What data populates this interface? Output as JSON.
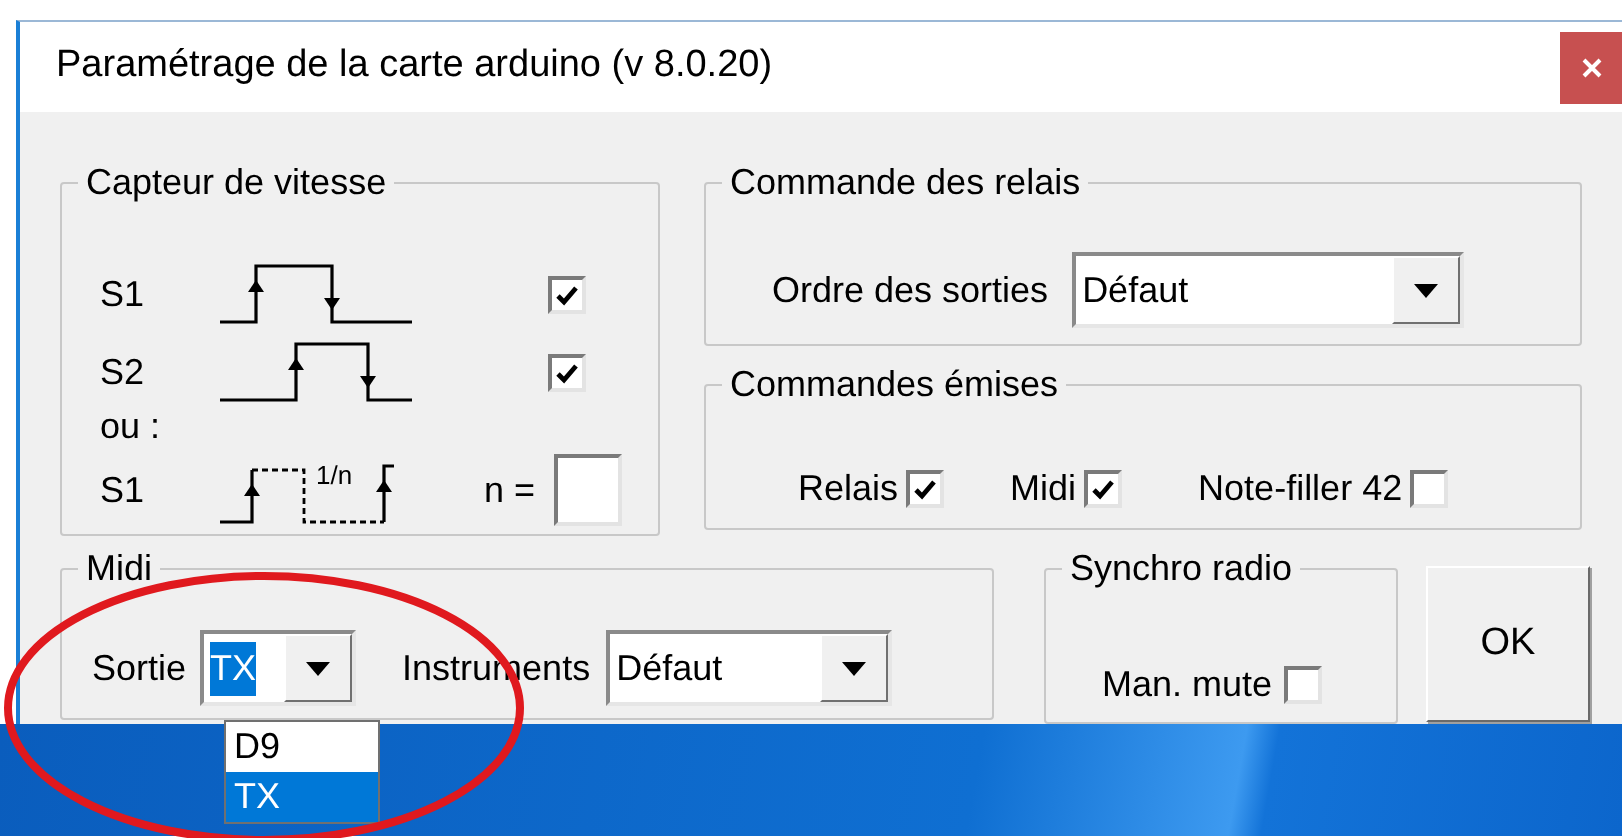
{
  "window": {
    "title": "Paramétrage de la carte arduino (v 8.0.20)"
  },
  "speed_sensor": {
    "title": "Capteur de vitesse",
    "rows": [
      {
        "kind": "checkbox",
        "label": "S1",
        "checked": true
      },
      {
        "kind": "checkbox",
        "label": "S2",
        "checked": true
      },
      {
        "kind": "note",
        "label": "ou :"
      },
      {
        "kind": "divider",
        "label": "S1",
        "ratio_label": "1/n",
        "field_label": "n ="
      }
    ]
  },
  "relay_control": {
    "title": "Commande des relais",
    "order_label": "Ordre des sorties",
    "order_value": "Défaut"
  },
  "sent_commands": {
    "title": "Commandes émises",
    "items": [
      {
        "label": "Relais",
        "checked": true
      },
      {
        "label": "Midi",
        "checked": true
      },
      {
        "label": "Note-filler 42",
        "checked": false
      }
    ]
  },
  "midi": {
    "title": "Midi",
    "output_label": "Sortie",
    "output_value": "TX",
    "instruments_label": "Instruments",
    "instruments_value": "Défaut",
    "output_options": [
      {
        "label": "D9",
        "selected": false
      },
      {
        "label": "TX",
        "selected": true
      }
    ]
  },
  "radio_sync": {
    "title": "Synchro radio",
    "items": [
      {
        "label": "Man. mute",
        "checked": false
      }
    ]
  },
  "ok_button": "OK"
}
